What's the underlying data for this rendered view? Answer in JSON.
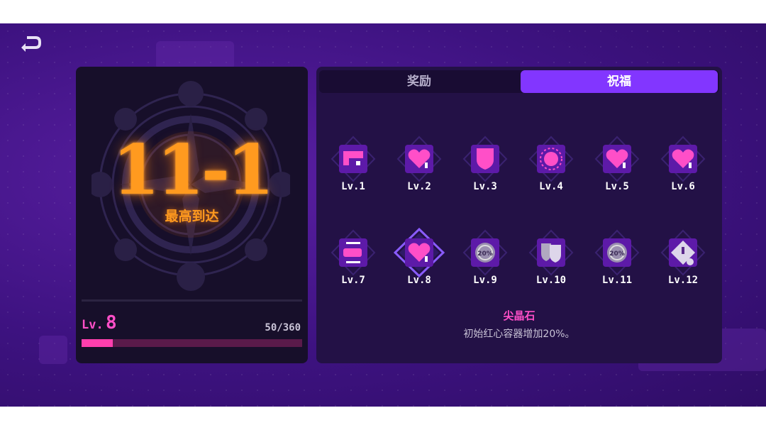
{
  "stage": {
    "number": "11-1",
    "caption": "最高到达"
  },
  "level": {
    "prefix": "Lv.",
    "value": "8",
    "xp": "50/360",
    "progress": 0.14
  },
  "tabs": [
    {
      "label": "奖励",
      "active": false
    },
    {
      "label": "祝福",
      "active": true
    }
  ],
  "blessings": [
    {
      "label": "Lv.1",
      "icon": "gun-icon"
    },
    {
      "label": "Lv.2",
      "icon": "heart-up-icon"
    },
    {
      "label": "Lv.3",
      "icon": "shield-icon"
    },
    {
      "label": "Lv.4",
      "icon": "sun-token-icon"
    },
    {
      "label": "Lv.5",
      "icon": "heart-up-icon"
    },
    {
      "label": "Lv.6",
      "icon": "heart-up-icon"
    },
    {
      "label": "Lv.7",
      "icon": "ammo-icon"
    },
    {
      "label": "Lv.8",
      "icon": "heart-up-icon",
      "selected": true
    },
    {
      "label": "Lv.9",
      "icon": "percent-gem-icon",
      "text": "20%"
    },
    {
      "label": "Lv.10",
      "icon": "twin-shield-icon"
    },
    {
      "label": "Lv.11",
      "icon": "percent-gem-icon",
      "text": "20%"
    },
    {
      "label": "Lv.12",
      "icon": "skull-diamond-icon"
    }
  ],
  "selected_blessing": {
    "title": "尖晶石",
    "description": "初始红心容器增加20%。"
  },
  "colors": {
    "accent": "#8236ff",
    "pink": "#ff4fc8",
    "orange": "#ff9a1f"
  }
}
